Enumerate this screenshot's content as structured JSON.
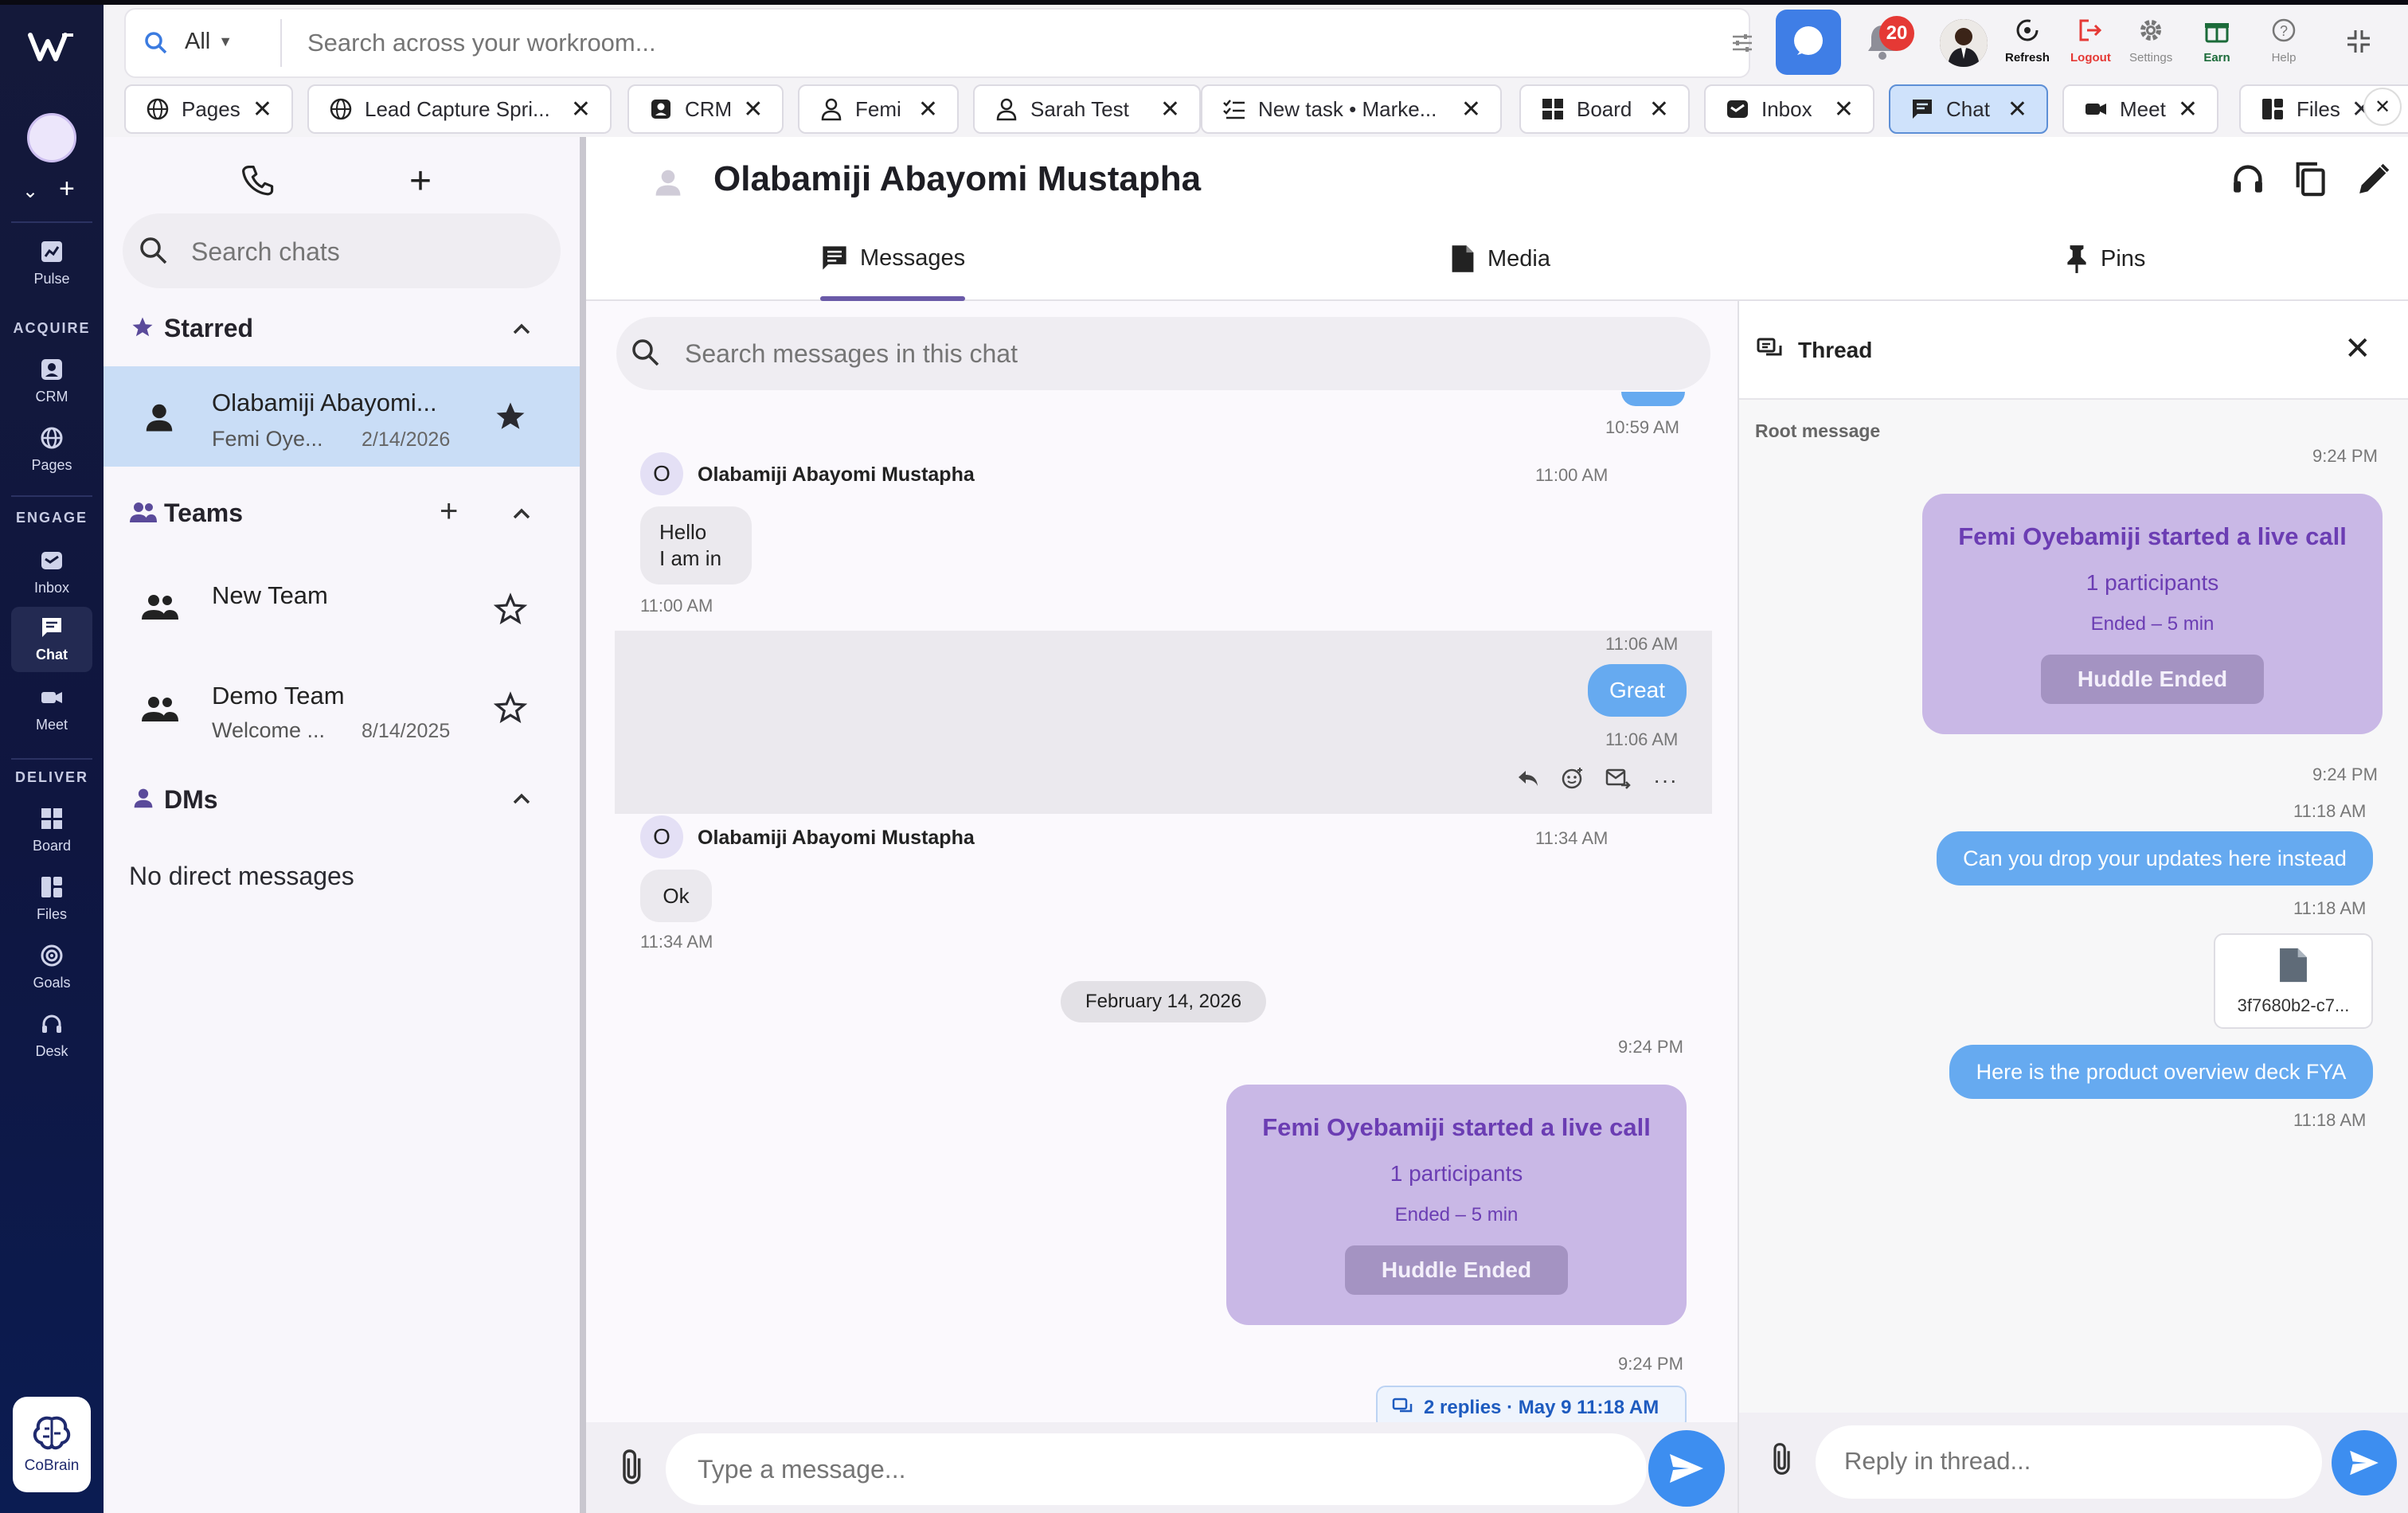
{
  "rail": {
    "items": [
      {
        "label": "Pulse"
      },
      {
        "label": "CRM"
      },
      {
        "label": "Pages"
      },
      {
        "label": "Inbox"
      },
      {
        "label": "Chat"
      },
      {
        "label": "Meet"
      },
      {
        "label": "Board"
      },
      {
        "label": "Files"
      },
      {
        "label": "Goals"
      },
      {
        "label": "Desk"
      }
    ],
    "sections": [
      "ACQUIRE",
      "ENGAGE",
      "DELIVER"
    ],
    "cobrain_label": "CoBrain"
  },
  "search": {
    "scope": "All",
    "placeholder": "Search across your workroom..."
  },
  "header_actions": {
    "notification_count": "20",
    "refresh": "Refresh",
    "logout": "Logout",
    "settings": "Settings",
    "earn": "Earn",
    "help": "Help"
  },
  "tabs": [
    {
      "label": "Pages"
    },
    {
      "label": "Lead Capture Spri..."
    },
    {
      "label": "CRM"
    },
    {
      "label": "Femi"
    },
    {
      "label": "Sarah Test"
    },
    {
      "label": "New task • Marke..."
    },
    {
      "label": "Board"
    },
    {
      "label": "Inbox"
    },
    {
      "label": "Chat"
    },
    {
      "label": "Meet"
    },
    {
      "label": "Files"
    }
  ],
  "sidebar": {
    "search_placeholder": "Search chats",
    "starred_title": "Starred",
    "starred_items": [
      {
        "name": "Olabamiji Abayomi...",
        "sub": "Femi Oye...",
        "date": "2/14/2026"
      }
    ],
    "teams_title": "Teams",
    "teams": [
      {
        "name": "New Team",
        "sub": "",
        "date": ""
      },
      {
        "name": "Demo Team",
        "sub": "Welcome ...",
        "date": "8/14/2025"
      }
    ],
    "dms_title": "DMs",
    "dms_empty": "No direct messages"
  },
  "chat": {
    "title": "Olabamiji Abayomi Mustapha",
    "tabs": [
      "Messages",
      "Media",
      "Pins"
    ],
    "search_placeholder": "Search messages in this chat",
    "messages": {
      "t0": "10:59 AM",
      "m1_sender": "Olabamiji Abayomi Mustapha",
      "m1_time": "11:00 AM",
      "m1_line1": "Hello",
      "m1_line2": "I am in",
      "m1_foot": "11:00 AM",
      "m2_time_top": "11:06 AM",
      "m2_text": "Great",
      "m2_time_bottom": "11:06 AM",
      "m3_sender": "Olabamiji Abayomi Mustapha",
      "m3_time": "11:34 AM",
      "m3_text": "Ok",
      "m3_foot": "11:34 AM",
      "date_chip": "February 14, 2026",
      "m4_time": "9:24 PM",
      "call_title": "Femi Oyebamiji started a live call",
      "call_participants": "1 participants",
      "call_ended": "Ended – 5 min",
      "call_button": "Huddle Ended",
      "m5_time": "9:24 PM",
      "replies": "2 replies · May 9 11:18 AM"
    },
    "composer_placeholder": "Type a message..."
  },
  "thread": {
    "title": "Thread",
    "root_label": "Root message",
    "root_time": "9:24 PM",
    "call_title": "Femi Oyebamiji started a live call",
    "call_participants": "1 participants",
    "call_ended": "Ended – 5 min",
    "call_button": "Huddle Ended",
    "t_after_call": "9:24 PM",
    "r1_time_top": "11:18 AM",
    "r1_text": "Can you drop your updates here instead",
    "r1_time": "11:18 AM",
    "file_name": "3f7680b2-c7...",
    "r2_text": "Here is the product overview deck FYA",
    "r2_time": "11:18 AM",
    "composer_placeholder": "Reply in thread..."
  },
  "colors": {
    "accent": "#5a3db0",
    "rail_bg": "#0f1640",
    "bubble_blue": "#66aaf0",
    "call_card": "#c9b8e6"
  }
}
